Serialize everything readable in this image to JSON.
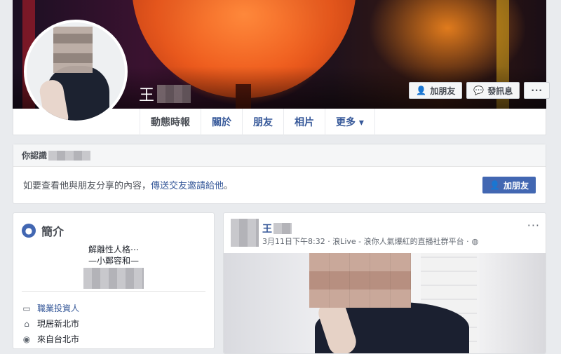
{
  "profile": {
    "name_visible": "王",
    "cover_buttons": {
      "add_friend": "加朋友",
      "message": "發訊息",
      "more": "···"
    }
  },
  "nav": {
    "tabs": [
      {
        "label": "動態時報"
      },
      {
        "label": "關於"
      },
      {
        "label": "朋友"
      },
      {
        "label": "相片"
      },
      {
        "label": "更多 ▾"
      }
    ]
  },
  "know_box": {
    "header": "你認識",
    "message_prefix": "如要查看他與朋友分享的內容，",
    "message_link": "傳送交友邀請給他",
    "message_suffix": "。",
    "add_friend_label": "加朋友"
  },
  "intro": {
    "title": "簡介",
    "bio_line1": "解離性人格⋯",
    "bio_line2": "—小鄭容和—",
    "job": "職業投資人",
    "lives": "現居新北市",
    "from": "來自台北市"
  },
  "post": {
    "author_visible": "王",
    "meta": "3月11日下午8:32 · 浪Live - 浪你人氣爆紅的直播社群平台 ·",
    "more": "···"
  },
  "colors": {
    "brand": "#4267b2",
    "link": "#365899",
    "background": "#e9ebee"
  }
}
